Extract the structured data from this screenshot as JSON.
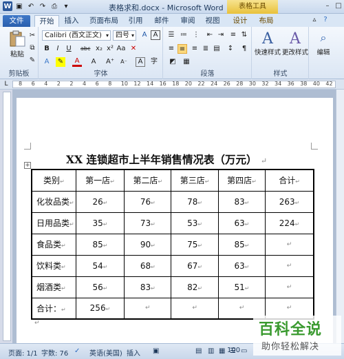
{
  "window": {
    "title": "表格求和.docx - Microsoft Word",
    "contextual_header": "表格工具"
  },
  "tabs": {
    "file": "文件",
    "home": "开始",
    "insert": "插入",
    "layout": "页面布局",
    "references": "引用",
    "mailings": "邮件",
    "review": "审阅",
    "view": "视图",
    "design": "设计",
    "table_layout": "布局"
  },
  "ribbon": {
    "clipboard": {
      "paste": "粘贴",
      "label": "剪贴板"
    },
    "font": {
      "name": "Calibri (西文正文)",
      "size": "四号",
      "label": "字体"
    },
    "paragraph": {
      "label": "段落"
    },
    "styles": {
      "quick": "快速样式",
      "change": "更改样式",
      "label": "样式"
    },
    "editing": {
      "label": "编辑"
    }
  },
  "ruler": {
    "ticks": [
      "8",
      "6",
      "4",
      "2",
      "2",
      "4",
      "6",
      "8",
      "10",
      "12",
      "14",
      "16",
      "18",
      "20",
      "22",
      "24",
      "26",
      "28",
      "30",
      "32",
      "34",
      "36",
      "38",
      "40",
      "42"
    ]
  },
  "document": {
    "table_title": "XX 连锁超市上半年销售情况表（万元）",
    "paragraph_mark": "↵",
    "table": {
      "headers": [
        "类别",
        "第一店",
        "第二店",
        "第三店",
        "第四店",
        "合计"
      ],
      "rows": [
        [
          "化妆品类",
          "26",
          "76",
          "78",
          "83",
          "263"
        ],
        [
          "日用品类",
          "35",
          "73",
          "53",
          "63",
          "224"
        ],
        [
          "食品类",
          "85",
          "90",
          "75",
          "85",
          ""
        ],
        [
          "饮料类",
          "54",
          "68",
          "67",
          "63",
          ""
        ],
        [
          "烟酒类",
          "56",
          "83",
          "82",
          "51",
          ""
        ],
        [
          "合计：",
          "256",
          "",
          "",
          "",
          ""
        ]
      ]
    }
  },
  "status": {
    "page": "页面: 1/1",
    "words": "字数: 76",
    "language": "英语(美国)",
    "mode": "插入",
    "zoom": "100"
  },
  "watermark": {
    "main": "百科全说",
    "sub": "助你轻松解决"
  }
}
